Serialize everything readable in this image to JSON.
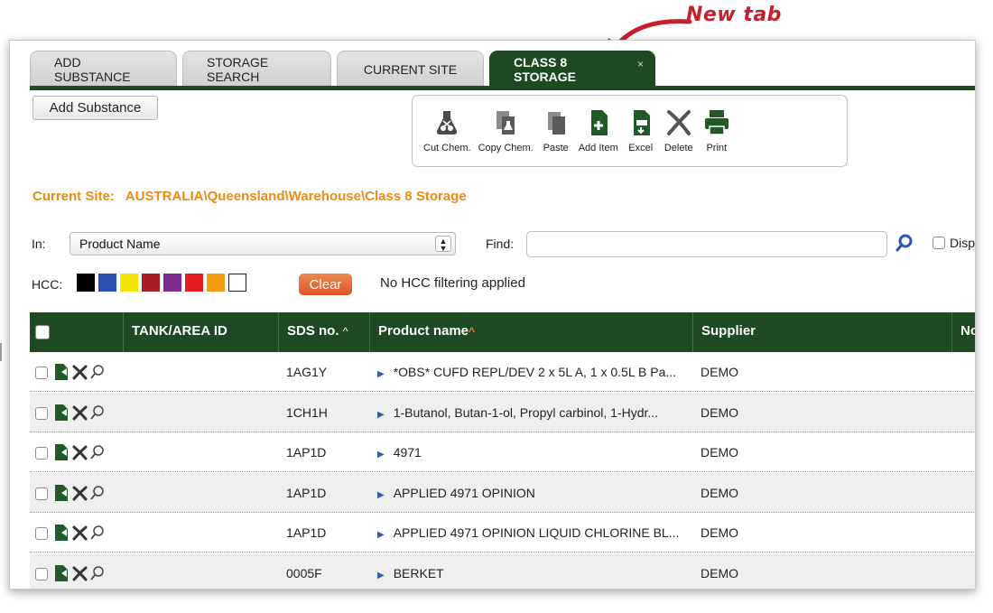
{
  "annotation": {
    "text": "New tab"
  },
  "tabs": [
    {
      "label": "ADD SUBSTANCE"
    },
    {
      "label": "STORAGE SEARCH"
    },
    {
      "label": "CURRENT SITE"
    },
    {
      "label": "CLASS 8 STORAGE",
      "close": "×",
      "active": true
    }
  ],
  "add_button": {
    "label": "Add Substance"
  },
  "toolbar": {
    "items": [
      {
        "label": "Cut Chem.",
        "icon": "flask-scissors-icon"
      },
      {
        "label": "Copy Chem.",
        "icon": "copy-chem-icon"
      },
      {
        "label": "Paste",
        "icon": "paste-icon"
      },
      {
        "label": "Add Item",
        "icon": "add-item-icon"
      },
      {
        "label": "Excel",
        "icon": "excel-icon"
      },
      {
        "label": "Delete",
        "icon": "delete-icon"
      },
      {
        "label": "Print",
        "icon": "print-icon"
      }
    ]
  },
  "current_site": {
    "label": "Current Site:",
    "path": "AUSTRALIA\\Queensland\\Warehouse\\Class 8 Storage"
  },
  "filters": {
    "in_label": "In:",
    "in_value": "Product Name",
    "find_label": "Find:",
    "find_value": "",
    "disp_label": "Disp"
  },
  "hcc": {
    "label": "HCC:",
    "colors": [
      "#000000",
      "#2d4fb3",
      "#f2e600",
      "#a61f24",
      "#7b2a8e",
      "#e31b23",
      "#f29c12",
      "#ffffff"
    ],
    "clear_label": "Clear",
    "status": "No HCC filtering applied"
  },
  "table": {
    "columns": [
      "TANK/AREA ID",
      "SDS no.",
      "Product name",
      "Supplier",
      "No"
    ],
    "sort_marker": "^",
    "rows": [
      {
        "tank": "",
        "sds": "1AG1Y",
        "product": "*OBS* CUFD REPL/DEV 2 x 5L A, 1 x 0.5L B Pa...",
        "supplier": "DEMO"
      },
      {
        "tank": "",
        "sds": "1CH1H",
        "product": "1-Butanol, Butan-1-ol, Propyl carbinol, 1-Hydr...",
        "supplier": "DEMO"
      },
      {
        "tank": "",
        "sds": "1AP1D",
        "product": "4971",
        "supplier": "DEMO"
      },
      {
        "tank": "",
        "sds": "1AP1D",
        "product": "APPLIED 4971 OPINION",
        "supplier": "DEMO"
      },
      {
        "tank": "",
        "sds": "1AP1D",
        "product": "APPLIED 4971 OPINION LIQUID CHLORINE BL...",
        "supplier": "DEMO"
      },
      {
        "tank": "",
        "sds": "0005F",
        "product": "BERKET",
        "supplier": "DEMO"
      }
    ]
  }
}
